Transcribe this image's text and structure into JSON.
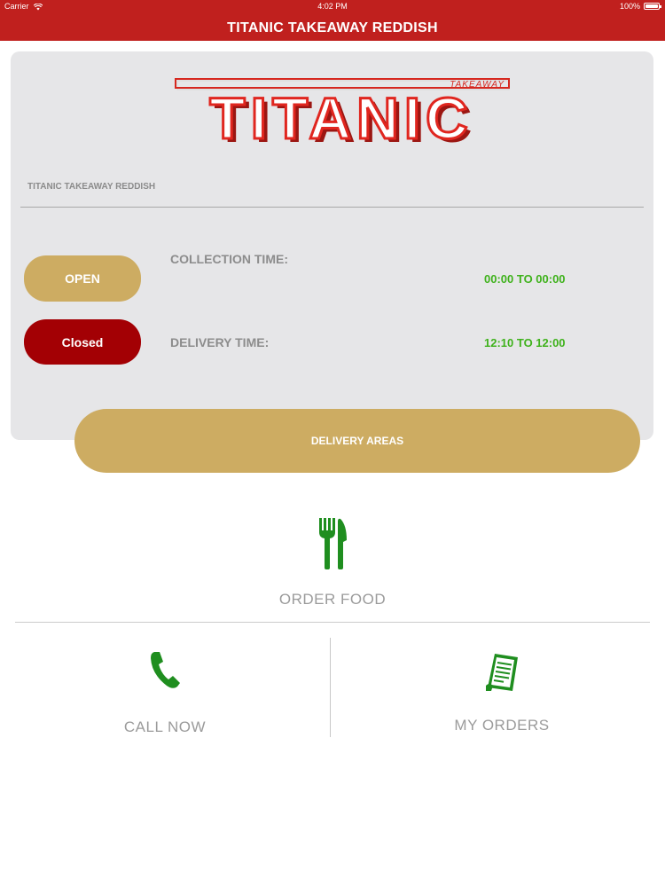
{
  "status_bar": {
    "carrier": "Carrier",
    "time": "4:02 PM",
    "battery": "100%"
  },
  "header": {
    "title": "TITANIC TAKEAWAY REDDISH"
  },
  "logo": {
    "main_text": "TITANIC",
    "sub_text": "TAKEAWAY"
  },
  "store": {
    "name": "TITANIC TAKEAWAY REDDISH"
  },
  "status_buttons": {
    "open_label": "OPEN",
    "closed_label": "Closed"
  },
  "times": {
    "collection_label": "COLLECTION TIME:",
    "collection_value": "00:00 TO 00:00",
    "delivery_label": "DELIVERY TIME:",
    "delivery_value": "12:10 TO 12:00"
  },
  "delivery_areas_label": "DELIVERY AREAS",
  "menu": {
    "order_food": "ORDER FOOD",
    "call_now": "CALL NOW",
    "my_orders": "MY ORDERS"
  },
  "colors": {
    "brand_red": "#c0201e",
    "gold": "#cdac62",
    "closed_red": "#a30004",
    "time_green": "#3fb21c",
    "icon_green": "#1f8e1f"
  }
}
